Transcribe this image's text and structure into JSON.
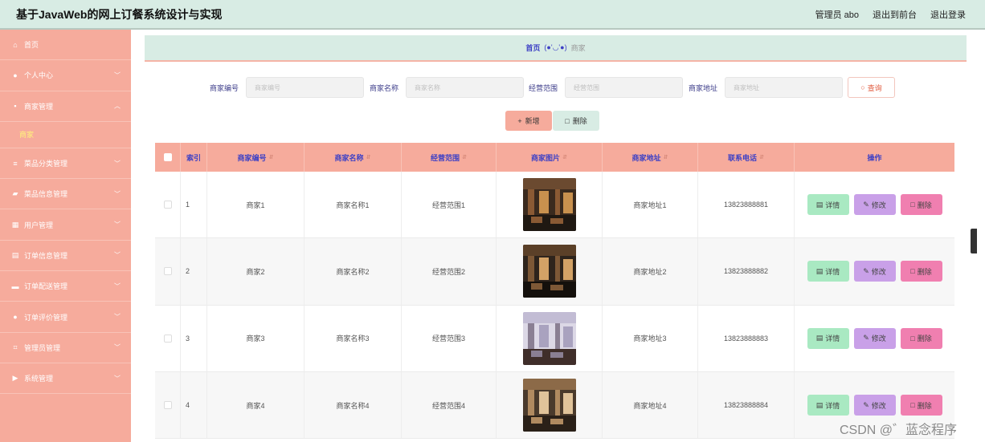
{
  "header": {
    "title": "基于JavaWeb的网上订餐系统设计与实现",
    "admin": "管理员 abo",
    "back_to_front": "退出到前台",
    "logout": "退出登录"
  },
  "sidebar": {
    "items": [
      {
        "label": "首页",
        "icon": "home-icon",
        "glyph": "⌂",
        "chevron": false
      },
      {
        "label": "个人中心",
        "icon": "user-icon",
        "glyph": "●",
        "chevron": true
      },
      {
        "label": "商家管理",
        "icon": "store-icon",
        "glyph": "▪",
        "chevron": true,
        "expanded": true,
        "sub": [
          "商家"
        ]
      },
      {
        "label": "菜品分类管理",
        "icon": "sliders-icon",
        "glyph": "≡",
        "chevron": true
      },
      {
        "label": "菜品信息管理",
        "icon": "chart-icon",
        "glyph": "▰",
        "chevron": true
      },
      {
        "label": "用户管理",
        "icon": "grid-icon",
        "glyph": "▦",
        "chevron": true
      },
      {
        "label": "订单信息管理",
        "icon": "document-icon",
        "glyph": "▤",
        "chevron": true
      },
      {
        "label": "订单配送管理",
        "icon": "monitor-icon",
        "glyph": "▬",
        "chevron": true
      },
      {
        "label": "订单评价管理",
        "icon": "person-icon",
        "glyph": "●",
        "chevron": true
      },
      {
        "label": "管理员管理",
        "icon": "crop-icon",
        "glyph": "⌗",
        "chevron": true
      },
      {
        "label": "系统管理",
        "icon": "video-icon",
        "glyph": "▶",
        "chevron": true
      }
    ]
  },
  "breadcrumb": {
    "home": "首页",
    "separator": "(●'◡'●)",
    "current": "商家"
  },
  "search": {
    "fields": [
      {
        "label": "商家编号",
        "placeholder": "商家编号"
      },
      {
        "label": "商家名称",
        "placeholder": "商家名称"
      },
      {
        "label": "经营范围",
        "placeholder": "经营范围"
      },
      {
        "label": "商家地址",
        "placeholder": "商家地址"
      }
    ],
    "query_button": "查询"
  },
  "actions": {
    "add": "新增",
    "delete": "删除"
  },
  "table": {
    "headers": [
      "索引",
      "商家编号",
      "商家名称",
      "经营范围",
      "商家图片",
      "商家地址",
      "联系电话",
      "操作"
    ],
    "rows": [
      {
        "index": "1",
        "code": "商家1",
        "name": "商家名称1",
        "scope": "经营范围1",
        "address": "商家地址1",
        "phone": "13823888881"
      },
      {
        "index": "2",
        "code": "商家2",
        "name": "商家名称2",
        "scope": "经营范围2",
        "address": "商家地址2",
        "phone": "13823888882"
      },
      {
        "index": "3",
        "code": "商家3",
        "name": "商家名称3",
        "scope": "经营范围3",
        "address": "商家地址3",
        "phone": "13823888883"
      },
      {
        "index": "4",
        "code": "商家4",
        "name": "商家名称4",
        "scope": "经营范围4",
        "address": "商家地址4",
        "phone": "13823888884"
      }
    ],
    "row_actions": {
      "detail": "详情",
      "edit": "修改",
      "delete": "删除"
    }
  },
  "watermark": "CSDN @゛蓝念程序",
  "colors": {
    "header_bg": "#d8ece4",
    "sidebar_bg": "#f6ab9c",
    "accent_text": "#3d40c5",
    "detail": "#a9e9c2",
    "edit": "#c9a0e8",
    "delete": "#f07fb0"
  }
}
